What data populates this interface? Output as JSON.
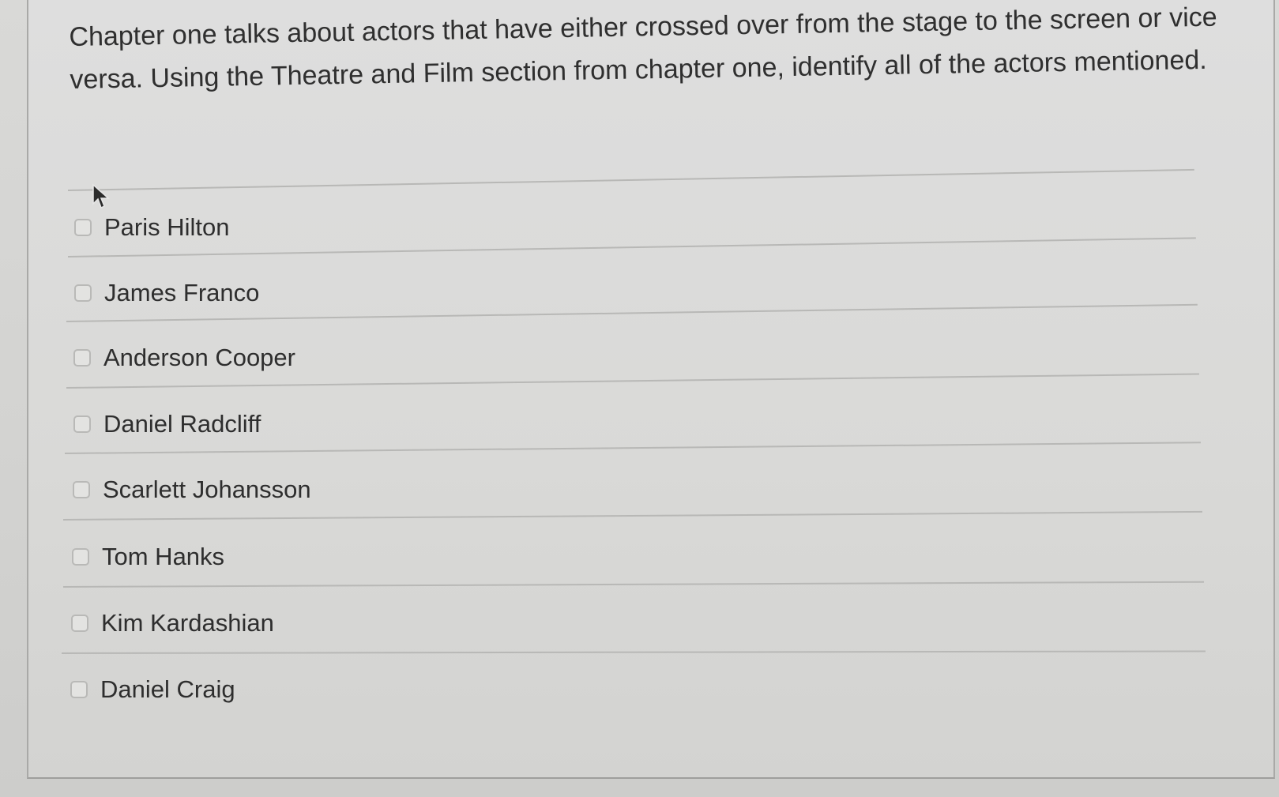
{
  "question": {
    "text": "Chapter one talks about actors that have either crossed over from the stage to the screen or vice versa.  Using the Theatre and Film section from chapter one, identify all of the actors mentioned."
  },
  "options": [
    {
      "label": "Paris Hilton",
      "checked": false
    },
    {
      "label": "James Franco",
      "checked": false
    },
    {
      "label": "Anderson Cooper",
      "checked": false
    },
    {
      "label": "Daniel Radcliff",
      "checked": false
    },
    {
      "label": "Scarlett Johansson",
      "checked": false
    },
    {
      "label": "Tom Hanks",
      "checked": false
    },
    {
      "label": "Kim Kardashian",
      "checked": false
    },
    {
      "label": "Daniel Craig",
      "checked": false
    }
  ],
  "cursor": "arrow-pointer-icon"
}
